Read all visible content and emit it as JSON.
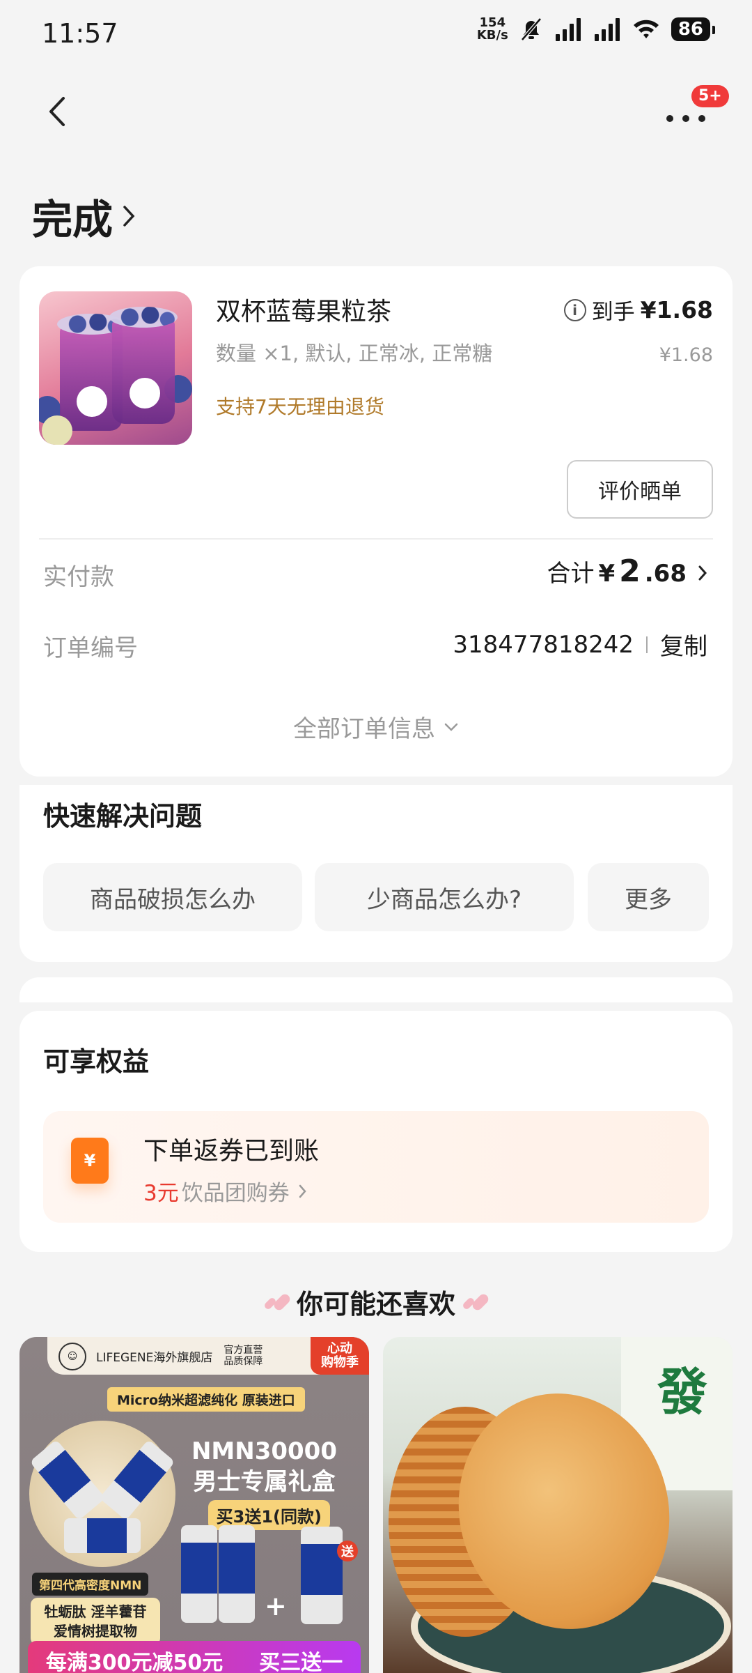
{
  "status_bar": {
    "time": "11:57",
    "net_speed_value": "154",
    "net_speed_unit": "KB/s",
    "battery": "86"
  },
  "nav": {
    "more_badge": "5+"
  },
  "page": {
    "title": "完成"
  },
  "order": {
    "product_name": "双杯蓝莓果粒茶",
    "spec": "数量 ×1, 默认, 正常冰, 正常糖",
    "return_policy": "支持7天无理由退货",
    "final_price_label": "到手",
    "final_price": "¥1.68",
    "original_price": "¥1.68",
    "review_button": "评价晒单",
    "paid_label": "实付款",
    "paid_total_prefix": "合计",
    "paid_currency": "¥",
    "paid_int": "2",
    "paid_dec": ".68",
    "order_no_label": "订单编号",
    "order_no": "318477818242",
    "copy_label": "复制",
    "all_info_label": "全部订单信息"
  },
  "quick_solve": {
    "title": "快速解决问题",
    "chips": [
      "商品破损怎么办",
      "少商品怎么办?",
      "更多"
    ]
  },
  "benefits": {
    "title": "可享权益",
    "main": "下单返券已到账",
    "amount": "3元",
    "coupon_name": "饮品团购券"
  },
  "recommend": {
    "title": "你可能还喜欢",
    "items": [
      {
        "store": "LIFEGENE海外旗舰店",
        "store_badge": "官方直营\n品质保障",
        "promo_tag": "心动\n购物季",
        "micro": "Micro纳米超滤纯化 原装进口",
        "headline": "NMN30000\n男士专属礼盒",
        "pill": "买3送1(同款)",
        "side1": "第四代高密度NMN",
        "side2": "牡蛎肽 淫羊藿苷\n爱情树提取物",
        "gift": "送",
        "bottom_left": "每满300元减50元",
        "bottom_right": "买三送一"
      },
      {
        "jar_char": "發"
      }
    ]
  }
}
